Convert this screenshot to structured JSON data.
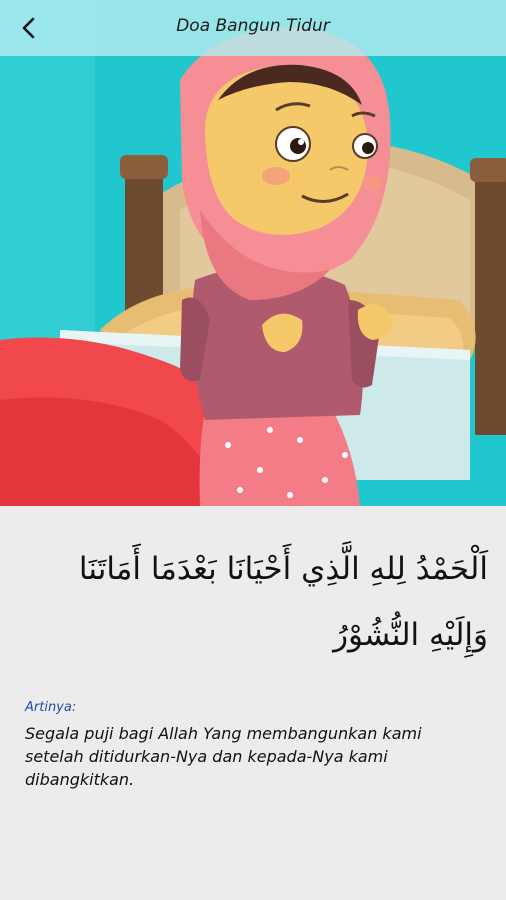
{
  "header": {
    "title": "Doa Bangun Tidur",
    "back_icon": "chevron-left-icon"
  },
  "illustration": {
    "subject": "girl-in-pink-hijab-on-bed",
    "colors": {
      "wall": "#21c7cf",
      "hijab": "#f58f95",
      "blanket": "#f0484d",
      "headboard": "#d7b98a",
      "skin": "#f5c96a"
    }
  },
  "prayer": {
    "arabic": "اَلْحَمْدُ لِلهِ الَّذِي أَحْيَانَا بَعْدَمَا أَمَاتَنَا وَإِلَيْهِ النُّشُوْرُ",
    "meaning_label": "Artinya:",
    "meaning_text": "Segala puji bagi Allah Yang membangunkan kami setelah ditidurkan-Nya dan kepada-Nya kami dibangkitkan."
  }
}
